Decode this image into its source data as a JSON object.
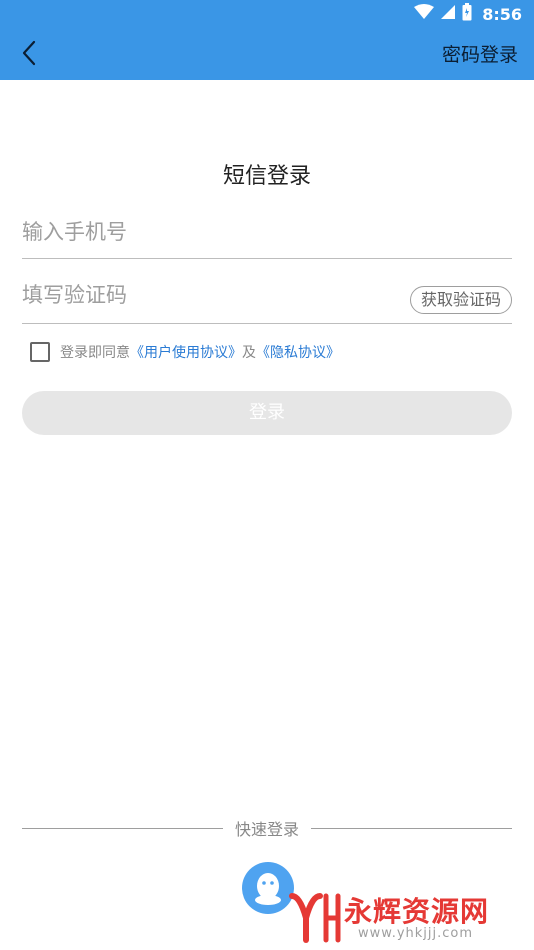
{
  "status_bar": {
    "time": "8:56",
    "icons": [
      "wifi-icon",
      "cell-signal-icon",
      "battery-icon"
    ]
  },
  "header": {
    "back_icon": "chevron-left-icon",
    "right_action": "密码登录",
    "color": "#3a96e6"
  },
  "title": "短信登录",
  "phone_field": {
    "placeholder": "输入手机号",
    "value": ""
  },
  "code_field": {
    "placeholder": "填写验证码",
    "value": "",
    "get_code_label": "获取验证码"
  },
  "agreement": {
    "checked": false,
    "prefix": "登录即同意",
    "user_agreement": "《用户使用协议》",
    "and": "及",
    "privacy": "《隐私协议》"
  },
  "login_button": {
    "label": "登录",
    "enabled": false
  },
  "quick_login": {
    "label": "快速登录",
    "providers": [
      "qq-icon"
    ]
  },
  "watermark": {
    "title": "永辉资源网",
    "url": "www.yhkjjj.com"
  }
}
